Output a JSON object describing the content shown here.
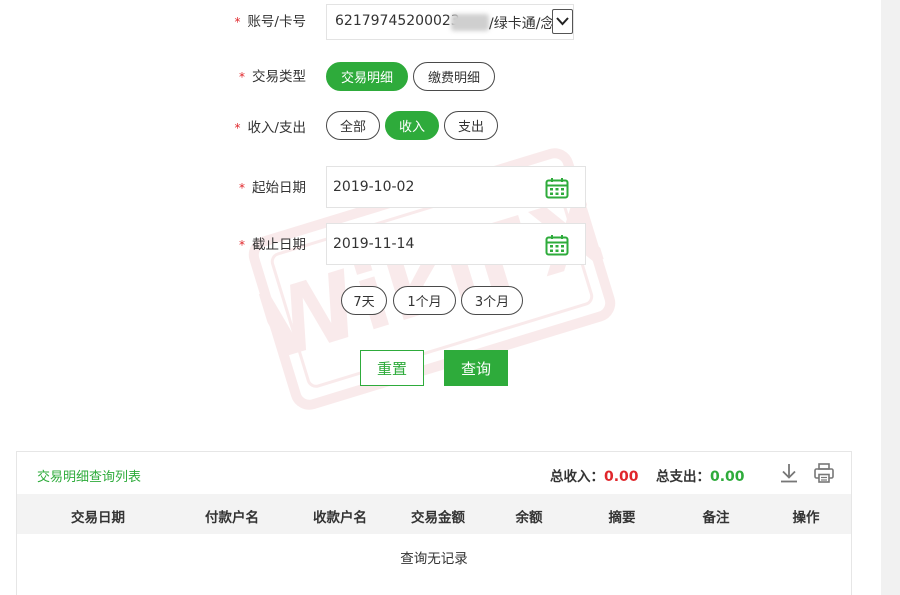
{
  "form": {
    "required_mark": "*",
    "account": {
      "label": "账号/卡号",
      "value_prefix": "62179745200023",
      "value_suffix": "/绿卡通/念"
    },
    "trans_type": {
      "label": "交易类型",
      "options": [
        "交易明细",
        "缴费明细"
      ],
      "selected": "交易明细"
    },
    "direction": {
      "label": "收入/支出",
      "options": [
        "全部",
        "收入",
        "支出"
      ],
      "selected": "收入"
    },
    "start_date": {
      "label": "起始日期",
      "value": "2019-10-02"
    },
    "end_date": {
      "label": "截止日期",
      "value": "2019-11-14"
    },
    "quick_ranges": [
      "7天",
      "1个月",
      "3个月"
    ],
    "reset_label": "重置",
    "query_label": "查询"
  },
  "watermark_text": "WikiFX",
  "result": {
    "title": "交易明细查询列表",
    "total_income_label": "总收入：",
    "total_income": "0.00",
    "total_expense_label": "总支出：",
    "total_expense": "0.00",
    "columns": [
      "交易日期",
      "付款户名",
      "收款户名",
      "交易金额",
      "余额",
      "摘要",
      "备注",
      "操作"
    ],
    "empty_text": "查询无记录"
  },
  "colors": {
    "accent": "#2eab3b",
    "income_value": "#e0262b",
    "expense_value": "#2eab3b",
    "required": "#e0262b"
  },
  "icons": [
    "calendar-icon",
    "download-icon",
    "print-icon",
    "chevron-down-icon"
  ]
}
